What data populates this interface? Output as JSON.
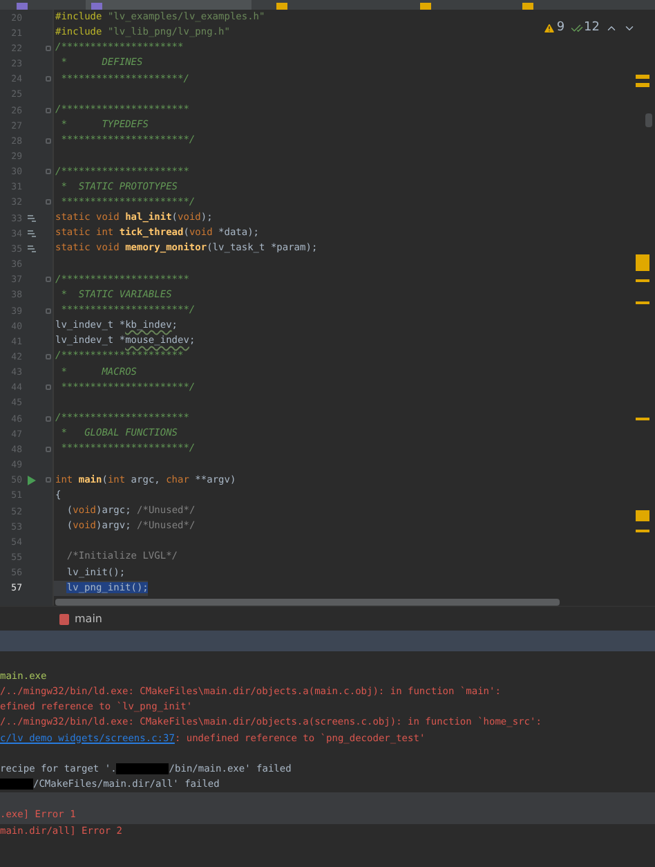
{
  "editor_tabs": [
    {
      "selected": false
    },
    {
      "selected": true
    },
    {
      "selected": false
    },
    {
      "selected": false
    },
    {
      "selected": false
    }
  ],
  "inspections": {
    "warnings": "9",
    "weak_warnings": "12"
  },
  "editor_lines": [
    {
      "number": "20",
      "tokens": [
        {
          "kind": "pp",
          "text": "#include "
        },
        {
          "kind": "str",
          "text": "\"lv_examples/lv_examples.h\""
        }
      ]
    },
    {
      "number": "21",
      "tokens": [
        {
          "kind": "pp",
          "text": "#include "
        },
        {
          "kind": "str",
          "text": "\"lv_lib_png/lv_png.h\""
        }
      ]
    },
    {
      "number": "22",
      "fold": true,
      "tokens": [
        {
          "kind": "doc",
          "text": "/*********************"
        }
      ]
    },
    {
      "number": "23",
      "tokens": [
        {
          "kind": "doc",
          "text": " *      DEFINES"
        }
      ]
    },
    {
      "number": "24",
      "fold": true,
      "tokens": [
        {
          "kind": "doc",
          "text": " *********************/"
        }
      ]
    },
    {
      "number": "25"
    },
    {
      "number": "26",
      "fold": true,
      "tokens": [
        {
          "kind": "doc",
          "text": "/**********************"
        }
      ]
    },
    {
      "number": "27",
      "tokens": [
        {
          "kind": "doc",
          "text": " *      TYPEDEFS"
        }
      ]
    },
    {
      "number": "28",
      "fold": true,
      "tokens": [
        {
          "kind": "doc",
          "text": " **********************/"
        }
      ]
    },
    {
      "number": "29"
    },
    {
      "number": "30",
      "fold": true,
      "tokens": [
        {
          "kind": "doc",
          "text": "/**********************"
        }
      ]
    },
    {
      "number": "31",
      "tokens": [
        {
          "kind": "doc",
          "text": " *  STATIC PROTOTYPES"
        }
      ]
    },
    {
      "number": "32",
      "fold": true,
      "tokens": [
        {
          "kind": "doc",
          "text": " **********************/"
        }
      ]
    },
    {
      "number": "33",
      "implemented": true,
      "tokens": [
        {
          "kind": "kw",
          "text": "static void "
        },
        {
          "kind": "fn",
          "text": "hal_init"
        },
        {
          "kind": "plain",
          "text": "("
        },
        {
          "kind": "kw",
          "text": "void"
        },
        {
          "kind": "plain",
          "text": ");"
        }
      ]
    },
    {
      "number": "34",
      "implemented": true,
      "tokens": [
        {
          "kind": "kw",
          "text": "static int "
        },
        {
          "kind": "fn",
          "text": "tick_thread"
        },
        {
          "kind": "plain",
          "text": "("
        },
        {
          "kind": "kw",
          "text": "void "
        },
        {
          "kind": "plain",
          "text": "*data);"
        }
      ]
    },
    {
      "number": "35",
      "implemented": true,
      "tokens": [
        {
          "kind": "kw",
          "text": "static void "
        },
        {
          "kind": "fn",
          "text": "memory_monitor"
        },
        {
          "kind": "plain",
          "text": "(lv_task_t *param);"
        }
      ]
    },
    {
      "number": "36"
    },
    {
      "number": "37",
      "fold": true,
      "tokens": [
        {
          "kind": "doc",
          "text": "/**********************"
        }
      ]
    },
    {
      "number": "38",
      "tokens": [
        {
          "kind": "doc",
          "text": " *  STATIC VARIABLES"
        }
      ]
    },
    {
      "number": "39",
      "fold": true,
      "tokens": [
        {
          "kind": "doc",
          "text": " **********************/"
        }
      ]
    },
    {
      "number": "40",
      "tokens": [
        {
          "kind": "plain",
          "text": "lv_indev_t *"
        },
        {
          "kind": "typo",
          "text": "kb_indev"
        },
        {
          "kind": "plain",
          "text": ";"
        }
      ]
    },
    {
      "number": "41",
      "tokens": [
        {
          "kind": "plain",
          "text": "lv_indev_t *"
        },
        {
          "kind": "typo",
          "text": "mouse_indev"
        },
        {
          "kind": "plain",
          "text": ";"
        }
      ]
    },
    {
      "number": "42",
      "fold": true,
      "tokens": [
        {
          "kind": "doc",
          "text": "/*********************"
        }
      ]
    },
    {
      "number": "43",
      "tokens": [
        {
          "kind": "doc",
          "text": " *      MACROS"
        }
      ]
    },
    {
      "number": "44",
      "fold": true,
      "tokens": [
        {
          "kind": "doc",
          "text": " **********************/"
        }
      ]
    },
    {
      "number": "45"
    },
    {
      "number": "46",
      "fold": true,
      "tokens": [
        {
          "kind": "doc",
          "text": "/**********************"
        }
      ]
    },
    {
      "number": "47",
      "tokens": [
        {
          "kind": "doc",
          "text": " *   GLOBAL FUNCTIONS"
        }
      ]
    },
    {
      "number": "48",
      "fold": true,
      "tokens": [
        {
          "kind": "doc",
          "text": " **********************/"
        }
      ]
    },
    {
      "number": "49"
    },
    {
      "number": "50",
      "runnable": true,
      "fold": true,
      "tokens": [
        {
          "kind": "kw",
          "text": "int "
        },
        {
          "kind": "fn",
          "text": "main"
        },
        {
          "kind": "plain",
          "text": "("
        },
        {
          "kind": "kw",
          "text": "int "
        },
        {
          "kind": "plain",
          "text": "argc, "
        },
        {
          "kind": "kw",
          "text": "char "
        },
        {
          "kind": "plain",
          "text": "**argv)"
        }
      ]
    },
    {
      "number": "51",
      "tokens": [
        {
          "kind": "plain",
          "text": "{"
        }
      ]
    },
    {
      "number": "52",
      "tokens": [
        {
          "kind": "plain",
          "text": "  ("
        },
        {
          "kind": "kw",
          "text": "void"
        },
        {
          "kind": "plain",
          "text": ")argc; "
        },
        {
          "kind": "cmt",
          "text": "/*Unused*/"
        }
      ]
    },
    {
      "number": "53",
      "tokens": [
        {
          "kind": "plain",
          "text": "  ("
        },
        {
          "kind": "kw",
          "text": "void"
        },
        {
          "kind": "plain",
          "text": ")argv; "
        },
        {
          "kind": "cmt",
          "text": "/*Unused*/"
        }
      ]
    },
    {
      "number": "54"
    },
    {
      "number": "55",
      "tokens": [
        {
          "kind": "cmt",
          "text": "  /*Initialize LVGL*/"
        }
      ]
    },
    {
      "number": "56",
      "tokens": [
        {
          "kind": "plain",
          "text": "  lv_init();"
        }
      ]
    },
    {
      "number": "57",
      "current": true,
      "indented": true,
      "tokens": [
        {
          "kind": "sel",
          "text": "lv_png_init();"
        }
      ]
    }
  ],
  "breadcrumb": {
    "label": "main"
  },
  "console_lines": [
    {
      "tokens": [
        {
          "kind": "success",
          "text": "main.exe"
        }
      ]
    },
    {
      "tokens": [
        {
          "kind": "error",
          "text": "/../mingw32/bin/ld.exe: CMakeFiles\\main.dir/objects.a(main.c.obj): in function `main':"
        }
      ]
    },
    {
      "tokens": [
        {
          "kind": "error",
          "text": "efined reference to `lv_png_init'"
        }
      ]
    },
    {
      "tokens": [
        {
          "kind": "error",
          "text": "/../mingw32/bin/ld.exe: CMakeFiles\\main.dir/objects.a(screens.c.obj): in function `home_src':"
        }
      ]
    },
    {
      "tokens": [
        {
          "kind": "link",
          "text": "c/lv_demo_widgets/screens.c:37"
        },
        {
          "kind": "error",
          "text": ": undefined reference to `png_decoder_test'"
        }
      ]
    },
    {
      "spaced": true,
      "tokens": [
        {
          "kind": "plain",
          "text": "recipe for target '."
        },
        {
          "kind": "redacted"
        },
        {
          "kind": "plain",
          "text": "/bin/main.exe' failed"
        }
      ]
    },
    {
      "tokens": [
        {
          "kind": "redacted"
        },
        {
          "kind": "plain",
          "text": "/CMakeFiles/main.dir/all' failed"
        }
      ]
    },
    {
      "spaced": true,
      "highlighted": true,
      "tokens": [
        {
          "kind": "error",
          "text": ".exe] Error 1"
        }
      ]
    },
    {
      "tokens": [
        {
          "kind": "error",
          "text": "main.dir/all] Error 2"
        }
      ]
    }
  ]
}
